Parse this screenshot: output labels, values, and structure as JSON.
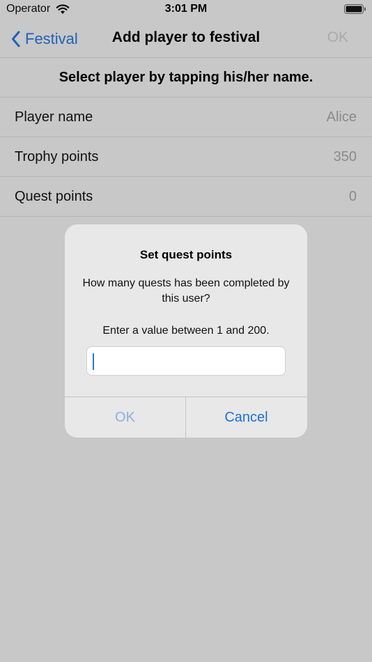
{
  "status_bar": {
    "carrier": "Operator",
    "time": "3:01 PM",
    "wifi_icon": "wifi-icon",
    "battery_icon": "battery-icon"
  },
  "nav": {
    "back_label": "Festival",
    "title": "Add player to festival",
    "ok_label": "OK",
    "accent_color": "#1f61b8",
    "disabled_color": "#aaaaaa"
  },
  "instruction": "Select player by tapping his/her name.",
  "rows": [
    {
      "label": "Player name",
      "value": "Alice"
    },
    {
      "label": "Trophy points",
      "value": "350"
    },
    {
      "label": "Quest points",
      "value": "0"
    }
  ],
  "alert": {
    "title": "Set quest points",
    "message": "How many quests has been completed by this user?",
    "hint": "Enter a value between 1 and 200.",
    "input_value": "",
    "ok_label": "OK",
    "cancel_label": "Cancel"
  }
}
